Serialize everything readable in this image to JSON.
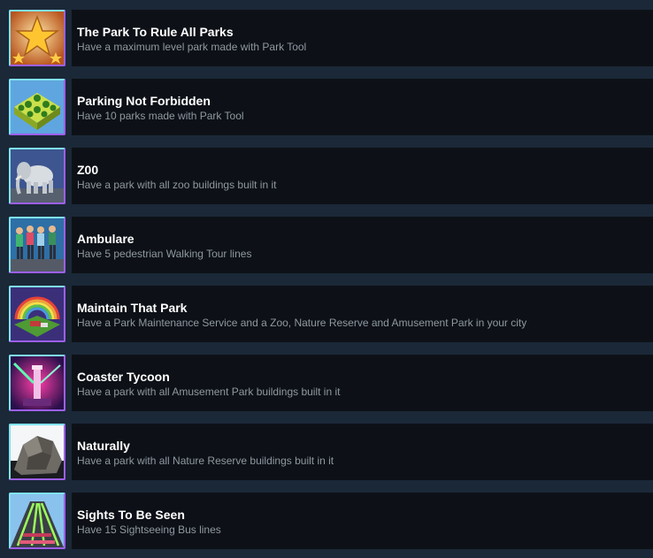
{
  "achievements": [
    {
      "title": "The Park To Rule All Parks",
      "description": "Have a maximum level park made with Park Tool",
      "icon": "gold-star-icon"
    },
    {
      "title": "Parking Not Forbidden",
      "description": "Have 10 parks made with Park Tool",
      "icon": "park-grid-icon"
    },
    {
      "title": "Z00",
      "description": "Have a park with all zoo buildings built in it",
      "icon": "elephant-icon"
    },
    {
      "title": "Ambulare",
      "description": "Have 5 pedestrian Walking Tour lines",
      "icon": "walkers-icon"
    },
    {
      "title": "Maintain That Park",
      "description": "Have a Park Maintenance Service and a Zoo, Nature Reserve and Amusement Park in your city",
      "icon": "rainbow-park-icon"
    },
    {
      "title": "Coaster Tycoon",
      "description": "Have a park with all Amusement Park buildings built in it",
      "icon": "coaster-tower-icon"
    },
    {
      "title": "Naturally",
      "description": "Have a park with all Nature Reserve buildings built in it",
      "icon": "rock-icon"
    },
    {
      "title": "Sights To Be Seen",
      "description": "Have 15 Sightseeing Bus lines",
      "icon": "bus-lines-icon"
    }
  ]
}
